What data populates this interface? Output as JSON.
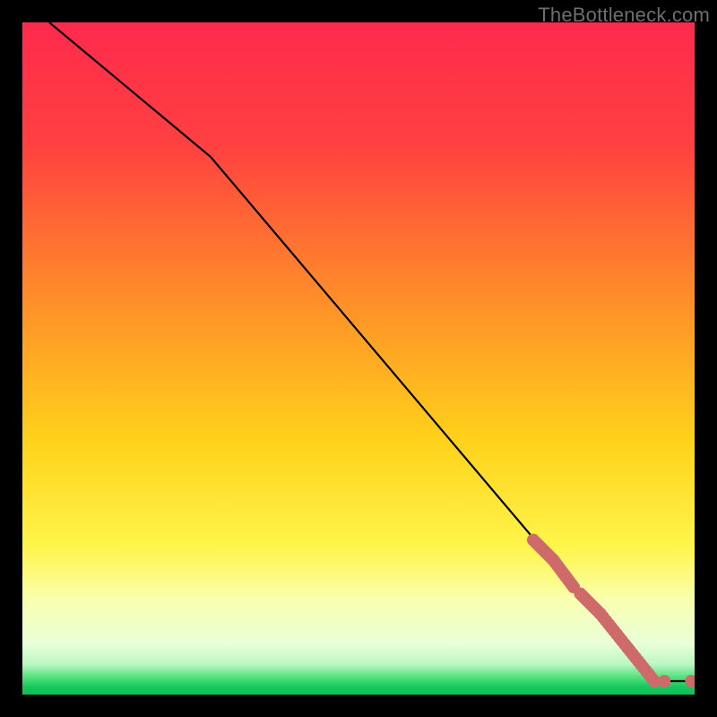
{
  "watermark": "TheBottleneck.com",
  "chart_data": {
    "type": "line",
    "title": "",
    "xlabel": "",
    "ylabel": "",
    "xlim": [
      0,
      100
    ],
    "ylim": [
      0,
      100
    ],
    "gradient_stops": [
      {
        "offset": 0,
        "color": "#ff2a4d"
      },
      {
        "offset": 0.18,
        "color": "#ff4040"
      },
      {
        "offset": 0.4,
        "color": "#ff8a2a"
      },
      {
        "offset": 0.62,
        "color": "#ffd11a"
      },
      {
        "offset": 0.78,
        "color": "#fff54a"
      },
      {
        "offset": 0.86,
        "color": "#f9ffb0"
      },
      {
        "offset": 0.925,
        "color": "#e8ffd8"
      },
      {
        "offset": 0.955,
        "color": "#baf7c4"
      },
      {
        "offset": 0.975,
        "color": "#4fe07a"
      },
      {
        "offset": 0.988,
        "color": "#18c85e"
      },
      {
        "offset": 1.0,
        "color": "#0fbf55"
      }
    ],
    "series": [
      {
        "name": "bottleneck-curve",
        "x": [
          4,
          28,
          94,
          100
        ],
        "y": [
          100,
          80,
          2,
          2
        ]
      }
    ],
    "marker_clusters": [
      {
        "x_start": 76,
        "x_end": 79,
        "y_start": 23,
        "y_end": 20,
        "density": "high"
      },
      {
        "x_start": 79,
        "x_end": 82,
        "y_start": 20,
        "y_end": 16,
        "density": "high"
      },
      {
        "x_start": 83,
        "x_end": 86,
        "y_start": 15,
        "y_end": 12,
        "density": "high"
      },
      {
        "x_start": 86,
        "x_end": 90,
        "y_start": 12,
        "y_end": 7,
        "density": "high"
      },
      {
        "x_start": 90,
        "x_end": 94,
        "y_start": 7,
        "y_end": 2,
        "density": "high"
      }
    ],
    "end_markers": [
      {
        "x": 95.5,
        "y": 2
      },
      {
        "x": 99.5,
        "y": 2
      }
    ],
    "marker_style": {
      "color": "#cf6a6a",
      "radius_px": 7
    }
  }
}
